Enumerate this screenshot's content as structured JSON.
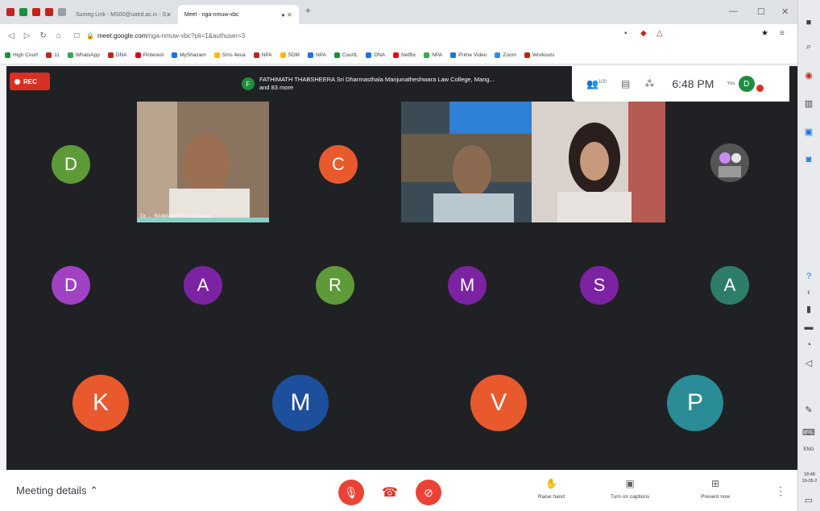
{
  "browser": {
    "tabs": [
      {
        "label": "Sumeg Link - MS00@uatrd.ac.in - S",
        "icon_color": "#c5221f"
      },
      {
        "label": "Meet - nga-nmuw-xbc",
        "icon_color": "#1e8e3e",
        "active": true
      }
    ],
    "url_host": "meet.google.com",
    "url_path": "/nga-nmuw-xbc?pli=1&authuser=3",
    "bookmarks": [
      {
        "label": "High Court",
        "color": "#1e8e3e"
      },
      {
        "label": "11",
        "color": "#c5221f"
      },
      {
        "label": "WhatsApp",
        "color": "#34a853"
      },
      {
        "label": "DNA",
        "color": "#c5221f"
      },
      {
        "label": "Pinterest",
        "color": "#e60023"
      },
      {
        "label": "MyShazam",
        "color": "#1a73e8"
      },
      {
        "label": "Sms 4eva",
        "color": "#fbbc04"
      },
      {
        "label": "NPA",
        "color": "#c5221f"
      },
      {
        "label": "SDM",
        "color": "#fbbc04"
      },
      {
        "label": "NPA",
        "color": "#1a73e8"
      },
      {
        "label": "CourtL",
        "color": "#1e8e3e"
      },
      {
        "label": "DNA",
        "color": "#1a73e8"
      },
      {
        "label": "Netflix",
        "color": "#e50914"
      },
      {
        "label": "NPA",
        "color": "#34a853"
      },
      {
        "label": "Prime Video",
        "color": "#1a73e8"
      },
      {
        "label": "Zoom",
        "color": "#2d8cff"
      },
      {
        "label": "Workouts",
        "color": "#c5221f"
      }
    ]
  },
  "meet": {
    "rec_label": "REC",
    "speaker_initial": "F",
    "speaker_line1": "FATHIMATH THABSHEERA Sri Dharmasthala Manjunatheshwara Law College, Mang...",
    "speaker_line2": "and 83 more",
    "people_count": "100",
    "time": "6:48 PM",
    "you_label": "You",
    "self_initial": "D",
    "video_label": "Dr. ... RAMANATH Sri Dharma...",
    "tiles_row1": [
      {
        "initial": "D",
        "color": "#5e9a37"
      },
      {
        "initial": "C",
        "color": "#e8592d"
      }
    ],
    "tiles_row2": [
      {
        "initial": "D",
        "color": "#a141c4"
      },
      {
        "initial": "A",
        "color": "#7b23a3"
      },
      {
        "initial": "R",
        "color": "#5e9a37"
      },
      {
        "initial": "M",
        "color": "#7b23a3"
      },
      {
        "initial": "S",
        "color": "#7b23a3"
      },
      {
        "initial": "A",
        "color": "#2e7d6b"
      }
    ],
    "tiles_row3": [
      {
        "initial": "K",
        "color": "#e8592d"
      },
      {
        "initial": "M",
        "color": "#1e4f9c"
      },
      {
        "initial": "V",
        "color": "#e8592d"
      },
      {
        "initial": "P",
        "color": "#2a8c96"
      }
    ]
  },
  "bottom": {
    "details_label": "Meeting details",
    "raise_hand": "Raise hand",
    "captions": "Turn on captions",
    "present": "Present now"
  },
  "taskbar": {
    "clock_time": "18:48",
    "clock_date": "19-05-2"
  }
}
